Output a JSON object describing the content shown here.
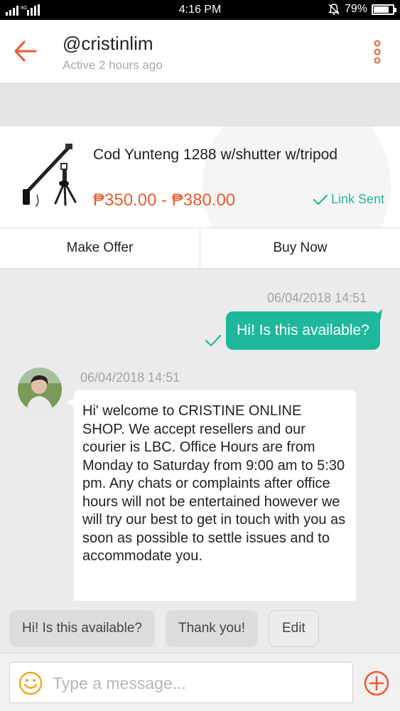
{
  "status_bar": {
    "network": "4G",
    "time": "4:16 PM",
    "battery": "79%",
    "battery_level": 0.79,
    "icons": [
      "signal-icon",
      "mute-bell-icon",
      "battery-icon"
    ]
  },
  "header": {
    "title": "@cristinlim",
    "subtitle": "Active 2 hours ago",
    "icons": [
      "back-arrow-icon",
      "more-vertical-icon"
    ]
  },
  "product": {
    "name": "Cod Yunteng 1288 w/shutter w/tripod",
    "price": "₱350.00 - ₱380.00",
    "status": "Link Sent",
    "make_offer": "Make Offer",
    "buy_now": "Buy Now"
  },
  "messages": [
    {
      "direction": "outgoing",
      "timestamp": "06/04/2018 14:51",
      "text": "Hi! Is this available?"
    },
    {
      "direction": "incoming",
      "timestamp": "06/04/2018 14:51",
      "text": "Hi' welcome to CRISTINE ONLINE SHOP. We accept resellers and our courier is LBC. Office Hours are from Monday to Saturday from 9:00 am to 5:30 pm. Any chats or complaints after office hours will not be entertained however we will try our best to get in touch with you as soon as possible to settle issues and to accommodate you."
    }
  ],
  "quick_replies": [
    "Hi! Is this available?",
    "Thank you!",
    "Edit"
  ],
  "composer": {
    "placeholder": "Type a message...",
    "icons": [
      "smiley-icon",
      "add-circle-icon"
    ]
  },
  "colors": {
    "accent": "#ee5a2c",
    "outgoing_bubble": "#1fb79c",
    "link_sent": "#26b59a"
  }
}
